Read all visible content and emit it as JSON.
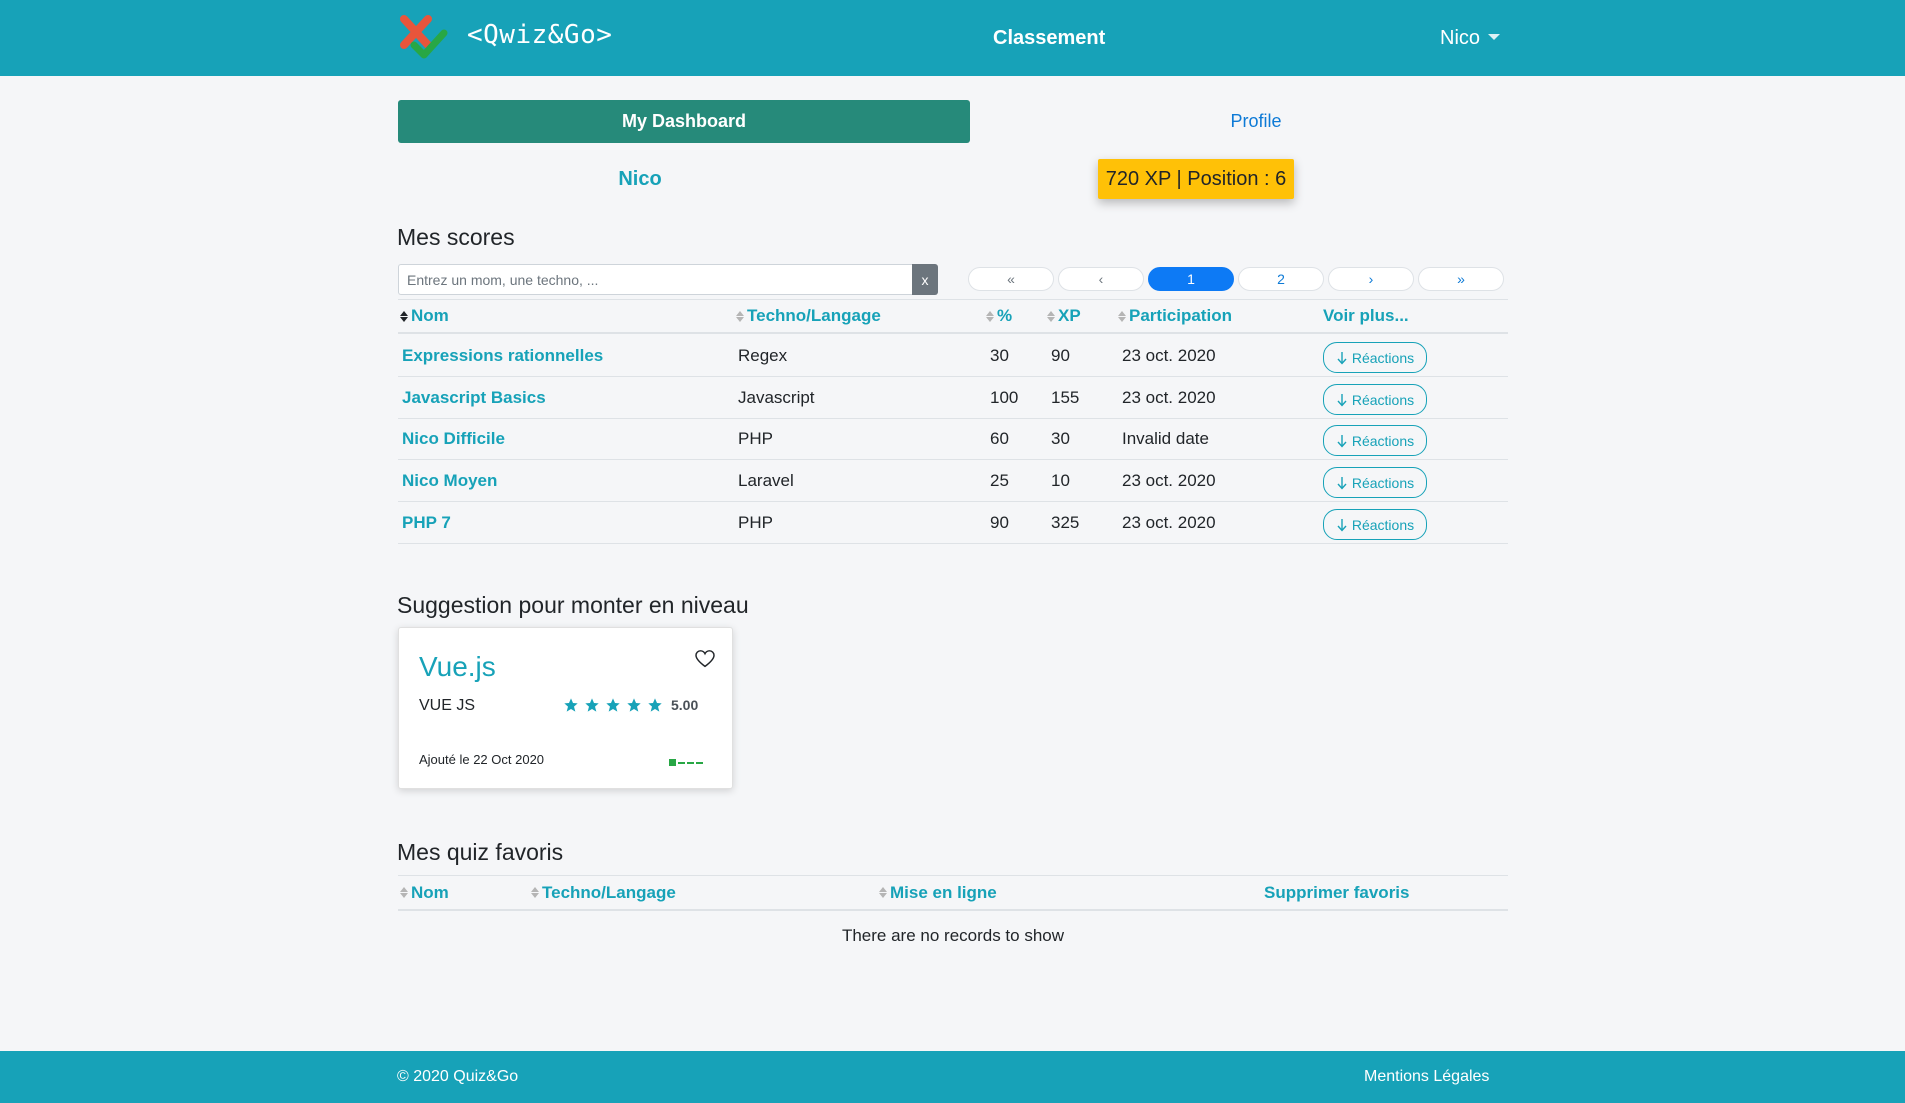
{
  "navbar": {
    "brand": "<Qwiz&Go>",
    "center_link": "Classement",
    "user_menu": "Nico"
  },
  "dashboard": {
    "tab_active": "My Dashboard",
    "tab_profile": "Profile",
    "user_name": "Nico",
    "xp_badge": "720 XP | Position : 6"
  },
  "scores": {
    "title": "Mes scores",
    "search_placeholder": "Entrez un mom, une techno, ...",
    "search_clear": "x",
    "pagination": [
      "«",
      "‹",
      "1",
      "2",
      "›",
      "»"
    ],
    "pagination_active": "1",
    "columns": [
      "Nom",
      "Techno/Langage",
      "%",
      "XP",
      "Participation",
      "Voir plus..."
    ],
    "rows": [
      {
        "name": "Expressions rationnelles",
        "techno": "Regex",
        "percent": "30",
        "xp": "90",
        "date": "23 oct. 2020",
        "action": "Réactions"
      },
      {
        "name": "Javascript Basics",
        "techno": "Javascript",
        "percent": "100",
        "xp": "155",
        "date": "23 oct. 2020",
        "action": "Réactions"
      },
      {
        "name": "Nico Difficile",
        "techno": "PHP",
        "percent": "60",
        "xp": "30",
        "date": "Invalid date",
        "action": "Réactions"
      },
      {
        "name": "Nico Moyen",
        "techno": "Laravel",
        "percent": "25",
        "xp": "10",
        "date": "23 oct. 2020",
        "action": "Réactions"
      },
      {
        "name": "PHP 7",
        "techno": "PHP",
        "percent": "90",
        "xp": "325",
        "date": "23 oct. 2020",
        "action": "Réactions"
      }
    ]
  },
  "suggestion": {
    "title": "Suggestion pour monter en niveau",
    "card": {
      "quiz_title": "Vue.js",
      "techno": "VUE JS",
      "rating": "5.00",
      "stars": 5,
      "date": "Ajouté le 22 Oct 2020",
      "level": 1,
      "level_max": 4
    }
  },
  "favorites": {
    "title": "Mes quiz favoris",
    "columns": [
      "Nom",
      "Techno/Langage",
      "Mise en ligne",
      "Supprimer favoris"
    ],
    "empty_text": "There are no records to show"
  },
  "footer": {
    "copyright": "© 2020 Quiz&Go",
    "legal": "Mentions Légales"
  },
  "colors": {
    "primary": "#17a2b8",
    "dashboard_tab": "#268a7a",
    "badge": "#ffc107",
    "link": "#0d7ad6",
    "pagination_active": "#0d7af5",
    "logo_red": "#e8553b",
    "logo_green": "#28a745"
  },
  "icons": {
    "logo": "x-check-logo",
    "sort": "sort-icon",
    "reactions": "arrow-down-icon",
    "favorite": "heart-icon",
    "rating": "star-icon",
    "user_dropdown": "caret-down-icon"
  }
}
